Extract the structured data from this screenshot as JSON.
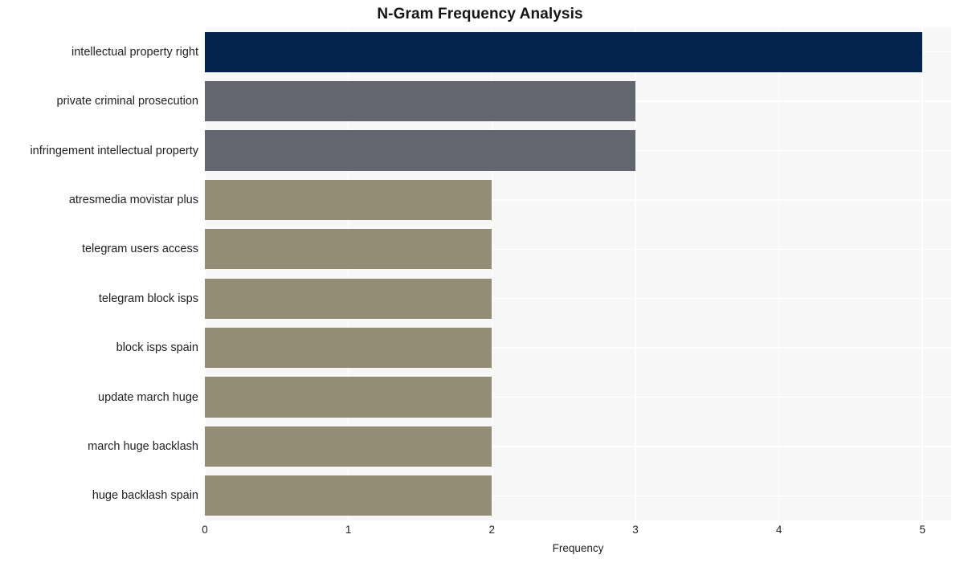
{
  "chart_data": {
    "type": "bar",
    "orientation": "horizontal",
    "title": "N-Gram Frequency Analysis",
    "xlabel": "Frequency",
    "ylabel": "",
    "xlim": [
      0,
      5.2
    ],
    "xticks": [
      "0",
      "1",
      "2",
      "3",
      "4",
      "5"
    ],
    "xtick_values": [
      0,
      1,
      2,
      3,
      4,
      5
    ],
    "grid": true,
    "legend": null,
    "categories": [
      "intellectual property right",
      "private criminal prosecution",
      "infringement intellectual property",
      "atresmedia movistar plus",
      "telegram users access",
      "telegram block isps",
      "block isps spain",
      "update march huge",
      "march huge backlash",
      "huge backlash spain"
    ],
    "values": [
      5,
      3,
      3,
      2,
      2,
      2,
      2,
      2,
      2,
      2
    ],
    "bar_colors": [
      "#04234d",
      "#63666f",
      "#63666f",
      "#948d75",
      "#948d75",
      "#948d75",
      "#948d75",
      "#948d75",
      "#948d75",
      "#948d75"
    ]
  },
  "style": {
    "plot_background": "#f7f7f8",
    "figure_background": "#ffffff",
    "grid_color": "#ffffff",
    "text_color": "#222222",
    "title_color": "#141414"
  }
}
